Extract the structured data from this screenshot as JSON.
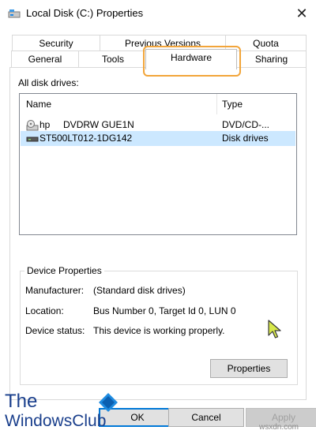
{
  "window": {
    "title": "Local Disk (C:) Properties",
    "close_glyph": "✕"
  },
  "tabs_row1": [
    "Security",
    "Previous Versions",
    "Quota"
  ],
  "tabs_row2": [
    "General",
    "Tools",
    "Hardware",
    "Sharing"
  ],
  "active_tab": "Hardware",
  "highlight_color": "#f2a53a",
  "drives": {
    "label": "All disk drives:",
    "columns": {
      "name": "Name",
      "type": "Type"
    },
    "rows": [
      {
        "icon": "dvd-drive-icon",
        "name": "hp     DVDRW GUE1N",
        "type": "DVD/CD-..."
      },
      {
        "icon": "hard-disk-icon",
        "name": "ST500LT012-1DG142",
        "type": "Disk drives",
        "selected": true
      }
    ]
  },
  "device_properties": {
    "title": "Device Properties",
    "manufacturer_label": "Manufacturer:",
    "manufacturer_value": "(Standard disk drives)",
    "location_label": "Location:",
    "location_value": "Bus Number 0, Target Id 0, LUN 0",
    "status_label": "Device status:",
    "status_value": "This device is working properly.",
    "properties_button": "Properties"
  },
  "buttons": {
    "ok": "OK",
    "cancel": "Cancel",
    "apply": "Apply"
  },
  "watermark": {
    "line1": "The",
    "line2": "WindowsClub",
    "site": "wsxdn.com"
  }
}
